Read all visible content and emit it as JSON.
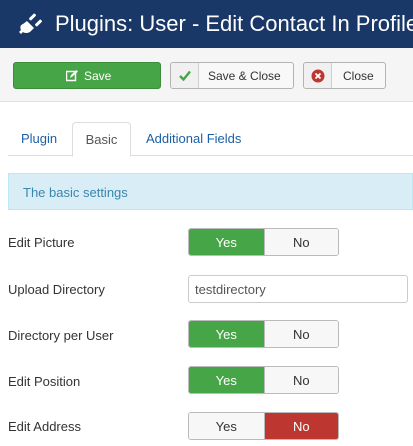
{
  "header": {
    "title": "Plugins: User - Edit Contact In Profile",
    "icon": "plug-icon"
  },
  "toolbar": {
    "save_label": "Save",
    "save_close_label": "Save & Close",
    "close_label": "Close"
  },
  "tabs": [
    {
      "label": "Plugin",
      "active": false
    },
    {
      "label": "Basic",
      "active": true
    },
    {
      "label": "Additional Fields",
      "active": false
    }
  ],
  "alert": {
    "text": "The basic settings"
  },
  "fields": {
    "edit_picture": {
      "label": "Edit Picture",
      "yes": "Yes",
      "no": "No",
      "value": "Yes"
    },
    "upload_directory": {
      "label": "Upload Directory",
      "value": "testdirectory"
    },
    "directory_per_user": {
      "label": "Directory per User",
      "yes": "Yes",
      "no": "No",
      "value": "Yes"
    },
    "edit_position": {
      "label": "Edit Position",
      "yes": "Yes",
      "no": "No",
      "value": "Yes"
    },
    "edit_address": {
      "label": "Edit Address",
      "yes": "Yes",
      "no": "No",
      "value": "No"
    }
  },
  "colors": {
    "header_bg": "#1a3867",
    "success": "#46a546",
    "danger": "#bd362f",
    "link": "#1d5fa5",
    "info_bg": "#d9edf7"
  }
}
